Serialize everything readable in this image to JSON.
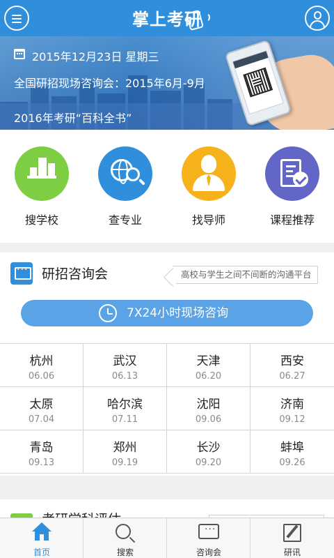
{
  "header": {
    "app_title": "掌上考研",
    "menu_icon": "menu-icon",
    "user_icon": "user-icon",
    "accent": "#2f8fdc"
  },
  "banner": {
    "date_text": "2015年12月23日 星期三",
    "line2": "全国研招现场咨询会：2015年6月-9月",
    "line3": "2016年考研“百科全书”"
  },
  "quick_actions": [
    {
      "label": "搜学校",
      "icon": "school-building-icon",
      "color": "#7dce42"
    },
    {
      "label": "查专业",
      "icon": "globe-search-icon",
      "color": "#2f8fdc"
    },
    {
      "label": "找导师",
      "icon": "tutor-icon",
      "color": "#f5b21b"
    },
    {
      "label": "课程推荐",
      "icon": "course-check-icon",
      "color": "#6266c6"
    }
  ],
  "consult": {
    "title": "研招咨询会",
    "tagline": "高校与学生之间不间断的沟通平台",
    "cta_label": "7X24小时现场咨询",
    "cities": [
      {
        "city": "杭州",
        "date": "06.06"
      },
      {
        "city": "武汉",
        "date": "06.13"
      },
      {
        "city": "天津",
        "date": "06.20"
      },
      {
        "city": "西安",
        "date": "06.27"
      },
      {
        "city": "太原",
        "date": "07.04"
      },
      {
        "city": "哈尔滨",
        "date": "07.11"
      },
      {
        "city": "沈阳",
        "date": "09.06"
      },
      {
        "city": "济南",
        "date": "09.12"
      },
      {
        "city": "青岛",
        "date": "09.13"
      },
      {
        "city": "郑州",
        "date": "09.19"
      },
      {
        "city": "长沙",
        "date": "09.20"
      },
      {
        "city": "蚌埠",
        "date": "09.26"
      }
    ]
  },
  "next_section": {
    "title": "考研学科评估"
  },
  "bottom_nav": [
    {
      "label": "首页",
      "icon": "home-icon",
      "active": true
    },
    {
      "label": "搜索",
      "icon": "search-icon",
      "active": false
    },
    {
      "label": "咨询会",
      "icon": "chat-icon",
      "active": false
    },
    {
      "label": "研讯",
      "icon": "edit-icon",
      "active": false
    }
  ]
}
